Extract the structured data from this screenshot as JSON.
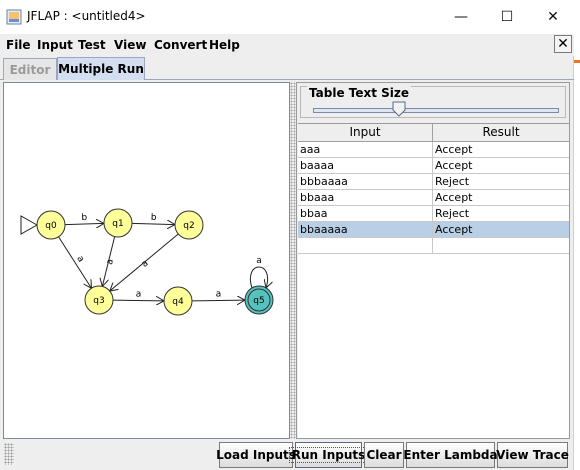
{
  "window": {
    "title": "JFLAP : <untitled4>",
    "controls": {
      "minimize": "—",
      "maximize": "☐",
      "close": "✕"
    }
  },
  "menu": {
    "items": [
      "File",
      "Input",
      "Test",
      "View",
      "Convert",
      "Help"
    ],
    "close_glyph": "✕"
  },
  "tabs": [
    {
      "label": "Editor",
      "active": false
    },
    {
      "label": "Multiple Run",
      "active": true
    }
  ],
  "automaton": {
    "states": [
      {
        "id": "q0",
        "initial": true,
        "final": false,
        "color": "#ffff99"
      },
      {
        "id": "q1",
        "initial": false,
        "final": false,
        "color": "#ffff99"
      },
      {
        "id": "q2",
        "initial": false,
        "final": false,
        "color": "#ffff99"
      },
      {
        "id": "q3",
        "initial": false,
        "final": false,
        "color": "#ffff99"
      },
      {
        "id": "q4",
        "initial": false,
        "final": false,
        "color": "#ffff99"
      },
      {
        "id": "q5",
        "initial": false,
        "final": true,
        "color": "#55c2bd"
      }
    ],
    "transitions": [
      {
        "from": "q0",
        "to": "q1",
        "label": "b"
      },
      {
        "from": "q1",
        "to": "q2",
        "label": "b"
      },
      {
        "from": "q0",
        "to": "q3",
        "label": "a"
      },
      {
        "from": "q1",
        "to": "q3",
        "label": "a"
      },
      {
        "from": "q2",
        "to": "q3",
        "label": "a"
      },
      {
        "from": "q3",
        "to": "q4",
        "label": "a"
      },
      {
        "from": "q4",
        "to": "q5",
        "label": "a"
      },
      {
        "from": "q5",
        "to": "q5",
        "label": "a"
      }
    ]
  },
  "table_text_size": {
    "label": "Table Text Size",
    "value_fraction": 0.35
  },
  "results_table": {
    "headers": [
      "Input",
      "Result"
    ],
    "rows": [
      {
        "input": "aaa",
        "result": "Accept",
        "selected": false
      },
      {
        "input": "baaaa",
        "result": "Accept",
        "selected": false
      },
      {
        "input": "bbbaaaa",
        "result": "Reject",
        "selected": false
      },
      {
        "input": "bbaaa",
        "result": "Accept",
        "selected": false
      },
      {
        "input": "bbaa",
        "result": "Reject",
        "selected": false
      },
      {
        "input": "bbaaaaa",
        "result": "Accept",
        "selected": true
      },
      {
        "input": "",
        "result": "",
        "selected": false
      }
    ]
  },
  "buttons": {
    "load_inputs": "Load Inputs",
    "run_inputs": "Run Inputs",
    "clear": "Clear",
    "enter_lambda": "Enter Lambda",
    "view_trace": "View Trace"
  }
}
